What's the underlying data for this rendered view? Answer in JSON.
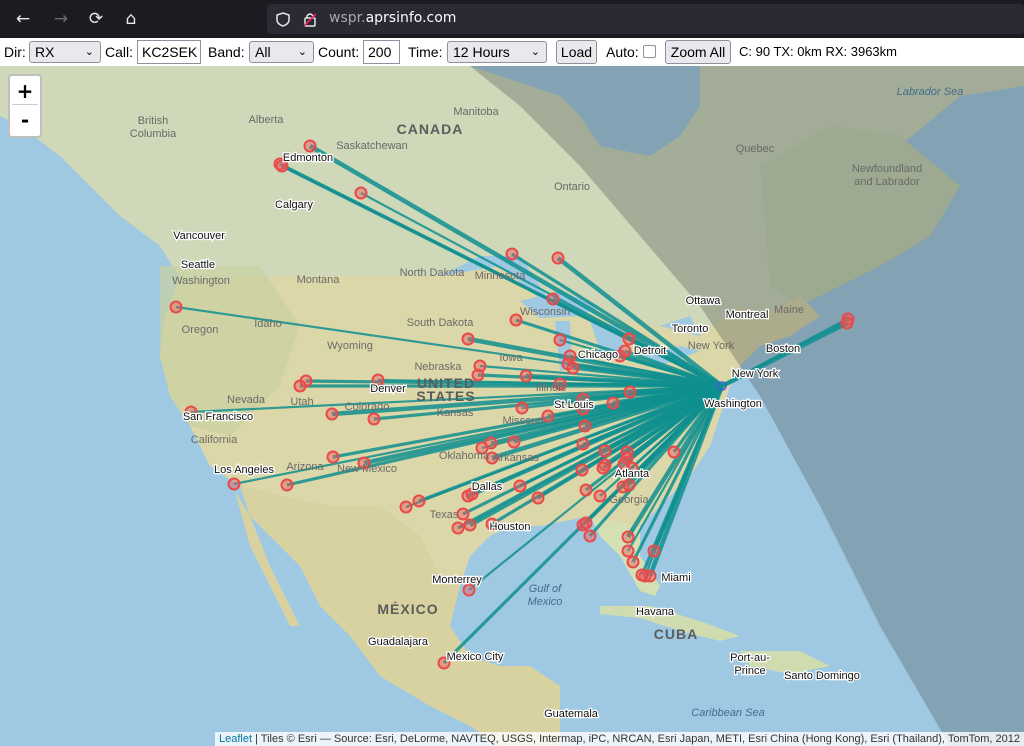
{
  "browser": {
    "url_domain": "wspr.",
    "url_main": "aprsinfo.com"
  },
  "toolbar": {
    "dir_label": "Dir:",
    "dir_value": "RX",
    "call_label": "Call:",
    "call_value": "KC2SEK",
    "band_label": "Band:",
    "band_value": "All",
    "count_label": "Count:",
    "count_value": "200",
    "time_label": "Time:",
    "time_value": "12 Hours",
    "load_button": "Load",
    "auto_label": "Auto:",
    "zoom_all_button": "Zoom All",
    "stats": "C: 90 TX: 0km RX: 3963km"
  },
  "map": {
    "zoom_in": "+",
    "zoom_out": "-",
    "attribution_link": "Leaflet",
    "attribution_text": " | Tiles © Esri — Source: Esri, DeLorme, NAVTEQ, USGS, Intermap, iPC, NRCAN, Esri Japan, METI, Esri China (Hong Kong), Esri (Thailand), TomTom, 2012",
    "labels": {
      "canada": "CANADA",
      "united_states": "UNITED\nSTATES",
      "mexico": "MÉXICO",
      "cuba": "CUBA",
      "alberta": "Alberta",
      "british_columbia": "British\nColumbia",
      "saskatchewan": "Saskatchewan",
      "manitoba": "Manitoba",
      "ontario": "Ontario",
      "quebec": "Quebec",
      "newfoundland": "Newfoundland\nand Labrador",
      "labrador_sea": "Labrador Sea",
      "washington_state": "Washington",
      "oregon": "Oregon",
      "idaho": "Idaho",
      "montana": "Montana",
      "wyoming": "Wyoming",
      "nevada": "Nevada",
      "utah": "Utah",
      "colorado": "Colorado",
      "california": "California",
      "arizona": "Arizona",
      "new_mexico": "New Mexico",
      "north_dakota": "North Dakota",
      "south_dakota": "South Dakota",
      "nebraska": "Nebraska",
      "kansas": "Kansas",
      "oklahoma": "Oklahoma",
      "texas": "Texas",
      "minnesota": "Minnesota",
      "wisconsin": "Wisconsin",
      "iowa": "Iowa",
      "illinois": "Illinois",
      "missouri": "Missouri",
      "arkansas": "Arkansas",
      "georgia": "Georgia",
      "new_york_state": "New York",
      "maine": "Maine",
      "gulf_of_mexico": "Gulf of\nMexico",
      "caribbean_sea": "Caribbean Sea",
      "edmonton": "Edmonton",
      "calgary": "Calgary",
      "vancouver": "Vancouver",
      "seattle": "Seattle",
      "san_francisco": "San Francisco",
      "los_angeles": "Los Angeles",
      "denver": "Denver",
      "dallas": "Dallas",
      "houston": "Houston",
      "chicago": "Chicago",
      "detroit": "Detroit",
      "st_louis": "St Louis",
      "atlanta": "Atlanta",
      "miami": "Miami",
      "toronto": "Toronto",
      "ottawa": "Ottawa",
      "montreal": "Montreal",
      "boston": "Boston",
      "new_york": "New York",
      "washington": "Washington",
      "monterrey": "Monterrey",
      "guadalajara": "Guadalajara",
      "mexico_city": "Mexico City",
      "havana": "Havana",
      "port_au_prince": "Port-au-\nPrince",
      "santo_domingo": "Santo Domingo",
      "guatemala": "Guatemala"
    },
    "colors": {
      "ocean": "#a6cde6",
      "land_us": "#d8d5a8",
      "path": "#0f8f8f",
      "spot": "#e84a4a",
      "night": "rgba(60,70,70,0.35)"
    },
    "home_station_call": "KC2SEK",
    "spot_count": 90
  }
}
